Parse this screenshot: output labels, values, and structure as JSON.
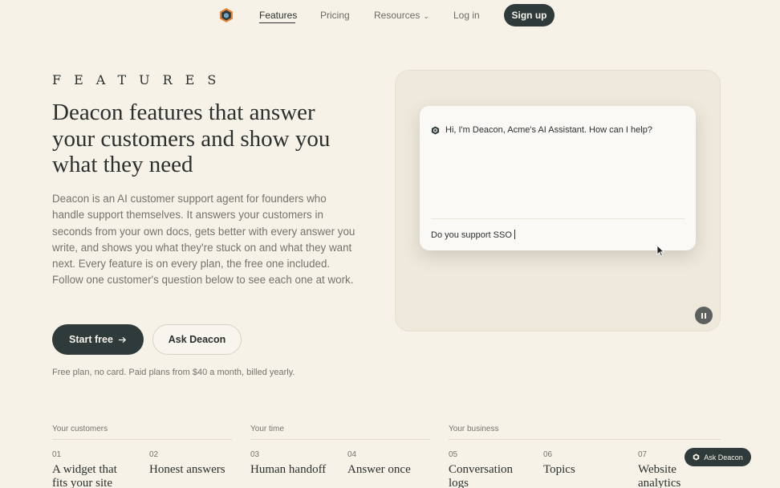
{
  "nav": {
    "links": [
      {
        "label": "Features"
      },
      {
        "label": "Pricing"
      },
      {
        "label": "Resources"
      },
      {
        "label": "Log in"
      }
    ],
    "signup_label": "Sign up"
  },
  "hero": {
    "eyebrow": "FEATURES",
    "headline": "Deacon features that answer your customers and show you what they need",
    "body": "Deacon is an AI customer support agent for founders who handle support themselves. It answers your customers in seconds from your own docs, gets better with every answer you write, and shows you what they're stuck on and what they want next. Every feature is on every plan, the free one included. Follow one customer's question below to see each one at work.",
    "start_label": "Start free",
    "ask_label": "Ask Deacon",
    "fineprint": "Free plan, no card. Paid plans from $40 a month, billed yearly."
  },
  "demo": {
    "greeting": "Hi, I'm Deacon, Acme's AI Assistant. How can I help?",
    "input_value": "Do you support SSO"
  },
  "groups": [
    {
      "label": "Your customers"
    },
    {
      "label": "Your time"
    },
    {
      "label": "Your business"
    }
  ],
  "features": [
    {
      "num": "01",
      "title": "A widget that fits your site"
    },
    {
      "num": "02",
      "title": "Honest answers"
    },
    {
      "num": "03",
      "title": "Human handoff"
    },
    {
      "num": "04",
      "title": "Answer once"
    },
    {
      "num": "05",
      "title": "Conversation logs"
    },
    {
      "num": "06",
      "title": "Topics"
    },
    {
      "num": "07",
      "title": "Website analytics"
    }
  ],
  "floating_ask_label": "Ask Deacon",
  "colors": {
    "accent": "#2f3b3b",
    "background": "#f6f2e8"
  }
}
